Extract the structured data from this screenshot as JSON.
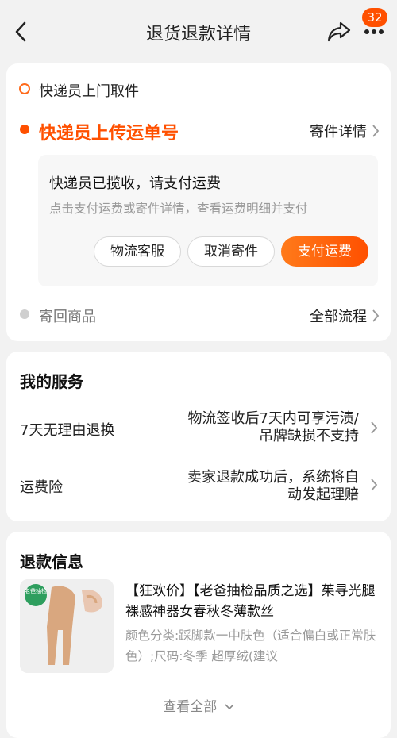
{
  "header": {
    "title": "退货退款详情",
    "badge_count": "32"
  },
  "progress": {
    "step1": "快递员上门取件",
    "step2": "快递员上传运单号",
    "step2_link": "寄件详情",
    "notice_title": "快递员已揽收，请支付运费",
    "notice_sub": "点击支付运费或寄件详情，查看运费明细并支付",
    "btn_service": "物流客服",
    "btn_cancel": "取消寄件",
    "btn_pay": "支付运费",
    "step3": "寄回商品",
    "step3_link": "全部流程"
  },
  "services": {
    "title": "我的服务",
    "row1_label": "7天无理由退换",
    "row1_value": "物流签收后7天内可享污渍/吊牌缺损不支持",
    "row2_label": "运费险",
    "row2_value": "卖家退款成功后，系统将自动发起理赔"
  },
  "refund": {
    "title": "退款信息",
    "thumb_tag": "老爸抽检",
    "product_title": "【狂欢价】【老爸抽检品质之选】茱寻光腿裸感神器女春秋冬薄款丝",
    "product_attr": "颜色分类:踩脚款一中肤色（适合偏白或正常肤色）;尺码:冬季 超厚绒(建议",
    "view_all": "查看全部"
  },
  "colors": {
    "accent": "#ff5000",
    "background": "#f2f2f2"
  }
}
